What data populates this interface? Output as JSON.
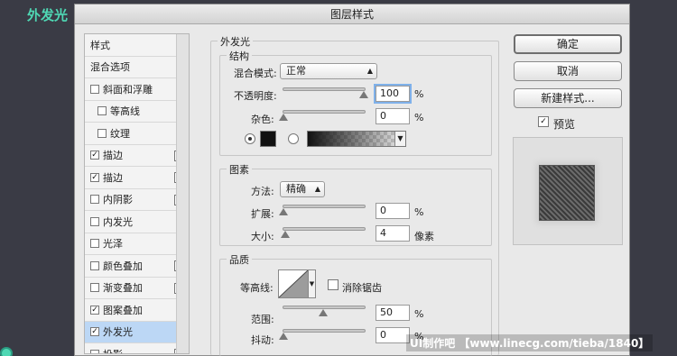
{
  "page_label": "外发光",
  "dialog": {
    "title": "图层样式"
  },
  "left_panel": {
    "items": [
      {
        "label": "样式",
        "checkbox": false,
        "checked": false,
        "plus": false
      },
      {
        "label": "混合选项",
        "checkbox": false,
        "checked": false,
        "plus": false
      },
      {
        "label": "斜面和浮雕",
        "checkbox": true,
        "checked": false,
        "plus": false
      },
      {
        "label": "等高线",
        "checkbox": true,
        "checked": false,
        "plus": false
      },
      {
        "label": "纹理",
        "checkbox": true,
        "checked": false,
        "plus": false
      },
      {
        "label": "描边",
        "checkbox": true,
        "checked": true,
        "plus": true
      },
      {
        "label": "描边",
        "checkbox": true,
        "checked": true,
        "plus": true
      },
      {
        "label": "内阴影",
        "checkbox": true,
        "checked": false,
        "plus": true
      },
      {
        "label": "内发光",
        "checkbox": true,
        "checked": false,
        "plus": false
      },
      {
        "label": "光泽",
        "checkbox": true,
        "checked": false,
        "plus": false
      },
      {
        "label": "颜色叠加",
        "checkbox": true,
        "checked": false,
        "plus": true
      },
      {
        "label": "渐变叠加",
        "checkbox": true,
        "checked": false,
        "plus": true
      },
      {
        "label": "图案叠加",
        "checkbox": true,
        "checked": true,
        "plus": false
      },
      {
        "label": "外发光",
        "checkbox": true,
        "checked": true,
        "plus": false
      },
      {
        "label": "投影",
        "checkbox": true,
        "checked": false,
        "plus": true
      }
    ]
  },
  "main": {
    "section_title": "外发光",
    "structure": {
      "title": "结构",
      "blend_mode_label": "混合模式:",
      "blend_mode_value": "正常",
      "opacity_label": "不透明度:",
      "opacity_value": "100",
      "noise_label": "杂色:",
      "noise_value": "0",
      "percent": "%"
    },
    "elements": {
      "title": "图素",
      "method_label": "方法:",
      "method_value": "精确",
      "spread_label": "扩展:",
      "spread_value": "0",
      "size_label": "大小:",
      "size_value": "4",
      "size_unit": "像素",
      "percent": "%"
    },
    "quality": {
      "title": "品质",
      "contour_label": "等高线:",
      "antialias_label": "消除锯齿",
      "range_label": "范围:",
      "range_value": "50",
      "jitter_label": "抖动:",
      "jitter_value": "0",
      "percent": "%"
    }
  },
  "buttons": {
    "ok": "确定",
    "cancel": "取消",
    "new_style": "新建样式...",
    "preview_label": "预览",
    "preview_checked": true
  },
  "watermark": "UI制作吧 【www.linecg.com/tieba/1840】",
  "sliders": {
    "opacity": 1.0,
    "noise": 0.0,
    "spread": 0.0,
    "size": 0.02,
    "range": 0.5,
    "jitter": 0.0
  }
}
